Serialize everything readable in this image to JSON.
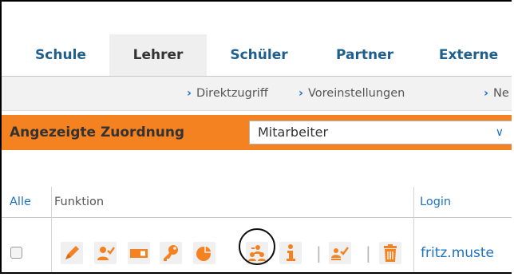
{
  "tabs": [
    {
      "label": "Schule"
    },
    {
      "label": "Lehrer",
      "active": true
    },
    {
      "label": "Schüler"
    },
    {
      "label": "Partner"
    },
    {
      "label": "Externe"
    }
  ],
  "breadcrumbs": [
    {
      "label": "Direktzugriff"
    },
    {
      "label": "Voreinstellungen"
    },
    {
      "label": "Ne"
    }
  ],
  "assignment": {
    "label": "Angezeigte Zuordnung",
    "selected": "Mitarbeiter"
  },
  "table": {
    "select_all_label": "Alle",
    "function_header": "Funktion",
    "login_header": "Login",
    "rows": [
      {
        "login": "fritz.muste"
      }
    ]
  },
  "colors": {
    "accent_orange": "#f58220",
    "link_blue": "#1d72c6",
    "tab_blue": "#1f5f8b"
  },
  "action_icons": [
    "pencil-icon",
    "user-check-icon",
    "card-icon",
    "key-icon",
    "pie-chart-icon",
    "group-assign-icon",
    "info-icon",
    "user-group-check-icon",
    "trash-icon"
  ]
}
